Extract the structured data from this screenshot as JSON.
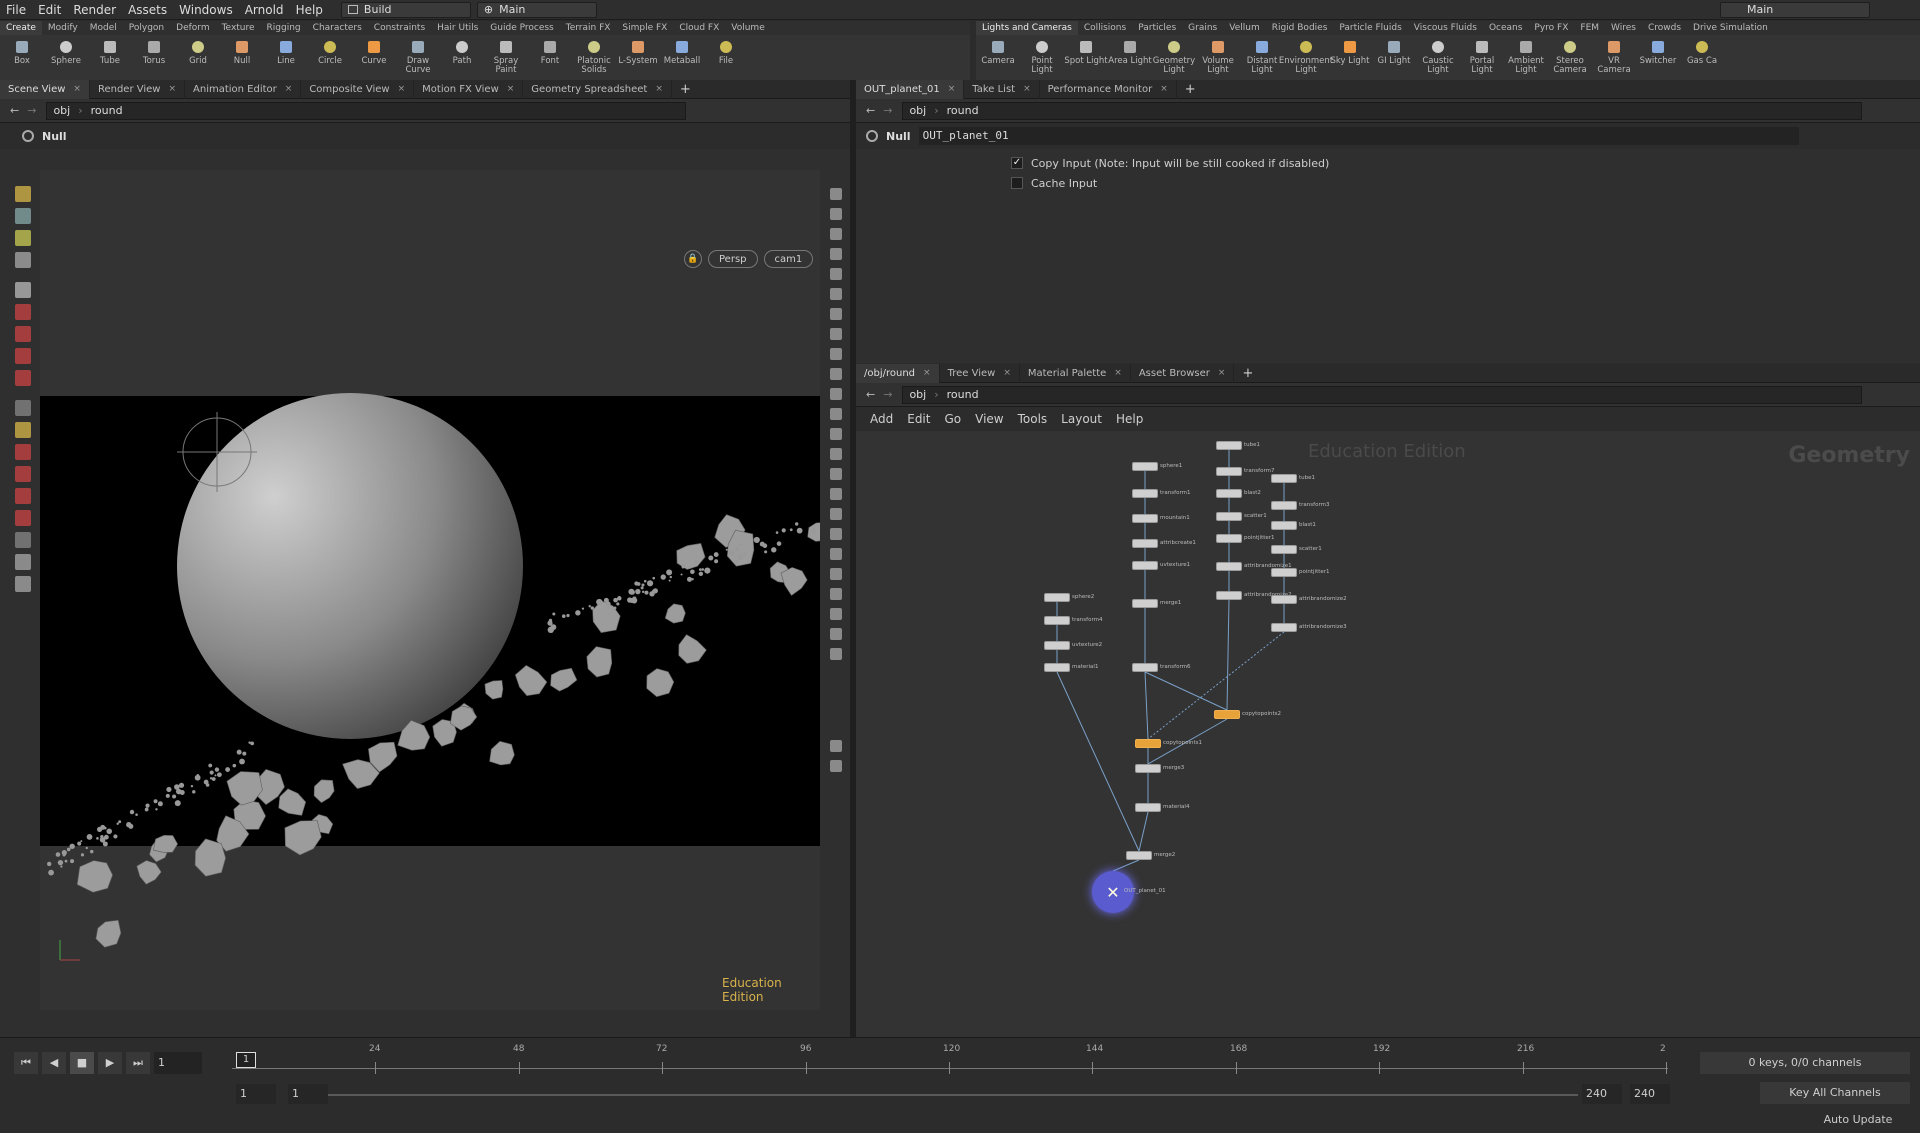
{
  "menubar": {
    "items": [
      "File",
      "Edit",
      "Render",
      "Assets",
      "Windows",
      "Arnold",
      "Help"
    ],
    "desktop": "Build",
    "context": "Main",
    "right_context": "Main"
  },
  "shelf_left": {
    "tabs": [
      "Create",
      "Modify",
      "Model",
      "Polygon",
      "Deform",
      "Texture",
      "Rigging",
      "Characters",
      "Constraints",
      "Hair Utils",
      "Guide Process",
      "Terrain FX",
      "Simple FX",
      "Cloud FX",
      "Volume"
    ],
    "tools": [
      "Box",
      "Sphere",
      "Tube",
      "Torus",
      "Grid",
      "Null",
      "Line",
      "Circle",
      "Curve",
      "Draw Curve",
      "Path",
      "Spray Paint",
      "Font",
      "Platonic Solids",
      "L-System",
      "Metaball",
      "File"
    ]
  },
  "shelf_right": {
    "tabs": [
      "Lights and Cameras",
      "Collisions",
      "Particles",
      "Grains",
      "Vellum",
      "Rigid Bodies",
      "Particle Fluids",
      "Viscous Fluids",
      "Oceans",
      "Pyro FX",
      "FEM",
      "Wires",
      "Crowds",
      "Drive Simulation"
    ],
    "tools": [
      "Camera",
      "Point Light",
      "Spot Light",
      "Area Light",
      "Geometry Light",
      "Volume Light",
      "Distant Light",
      "Environment Light",
      "Sky Light",
      "GI Light",
      "Caustic Light",
      "Portal Light",
      "Ambient Light",
      "Stereo Camera",
      "VR Camera",
      "Switcher",
      "Gas Ca"
    ]
  },
  "left_pane": {
    "tabs": [
      "Scene View",
      "Render View",
      "Animation Editor",
      "Composite View",
      "Motion FX View",
      "Geometry Spreadsheet"
    ],
    "path_root": "obj",
    "path_node": "round",
    "op_type": "Null",
    "persp": "Persp",
    "cam": "cam1",
    "edition": "Education Edition"
  },
  "param_pane": {
    "tabs": [
      "OUT_planet_01",
      "Take List",
      "Performance Monitor"
    ],
    "path_root": "obj",
    "path_node": "round",
    "node_type": "Null",
    "node_name": "OUT_planet_01",
    "copy_input_label": "Copy Input (Note: Input will be still cooked if disabled)",
    "copy_input_checked": true,
    "cache_input_label": "Cache Input",
    "cache_input_checked": false
  },
  "network_pane": {
    "tabs": [
      "/obj/round",
      "Tree View",
      "Material Palette",
      "Asset Browser"
    ],
    "path_root": "obj",
    "path_node": "round",
    "menu": [
      "Add",
      "Edit",
      "Go",
      "View",
      "Tools",
      "Layout",
      "Help"
    ],
    "watermark": "Education Edition",
    "context_label": "Geometry",
    "nodes": [
      {
        "id": "tube1",
        "label": "tube1"
      },
      {
        "id": "transform7",
        "label": "transform7"
      },
      {
        "id": "blast2",
        "label": "blast2"
      },
      {
        "id": "scatter1a",
        "label": "scatter1"
      },
      {
        "id": "pointjitter1a",
        "label": "pointjitter1"
      },
      {
        "id": "attribrandomize1",
        "label": "attribrandomize1"
      },
      {
        "id": "attribrandomize2a",
        "label": "attribrandomize2"
      },
      {
        "id": "tube2",
        "label": "tube1"
      },
      {
        "id": "transform3",
        "label": "transform3"
      },
      {
        "id": "blast1",
        "label": "blast1"
      },
      {
        "id": "scatter1",
        "label": "scatter1"
      },
      {
        "id": "pointjitter1",
        "label": "pointjitter1"
      },
      {
        "id": "attribrandomize2",
        "label": "attribrandomize2"
      },
      {
        "id": "attribrandomize3",
        "label": "attribrandomize3"
      },
      {
        "id": "sphere1",
        "label": "sphere1"
      },
      {
        "id": "transform1",
        "label": "transform1"
      },
      {
        "id": "mountain1",
        "label": "mountain1"
      },
      {
        "id": "attribcreate1",
        "label": "attribcreate1"
      },
      {
        "id": "uvtexture1",
        "label": "uvtexture1"
      },
      {
        "id": "merge1",
        "label": "merge1"
      },
      {
        "id": "transform6",
        "label": "transform6"
      },
      {
        "id": "sphere2",
        "label": "sphere2"
      },
      {
        "id": "transform4",
        "label": "transform4"
      },
      {
        "id": "uvtexture2",
        "label": "uvtexture2"
      },
      {
        "id": "material1",
        "label": "material1"
      },
      {
        "id": "copytopoints2",
        "label": "copytopoints2"
      },
      {
        "id": "copytopoints1",
        "label": "copytopoints1"
      },
      {
        "id": "merge3",
        "label": "merge3"
      },
      {
        "id": "material4",
        "label": "material4"
      },
      {
        "id": "merge2",
        "label": "merge2"
      },
      {
        "id": "out",
        "label": "OUT_planet_01"
      }
    ]
  },
  "timeline": {
    "current_frame": "1",
    "frame_marker": "1",
    "ticks": [
      "24",
      "48",
      "72",
      "96",
      "120",
      "144",
      "168",
      "192",
      "216",
      "2"
    ],
    "start": "1",
    "start2": "1",
    "end": "240",
    "end2": "240",
    "keys_status": "0 keys, 0/0 channels",
    "key_all": "Key All Channels",
    "auto_update": "Auto Update"
  },
  "colors": {
    "accent_orange": "#e8a23a",
    "selected_blue": "#5b5bd0",
    "edition_text": "#d8b24a"
  }
}
